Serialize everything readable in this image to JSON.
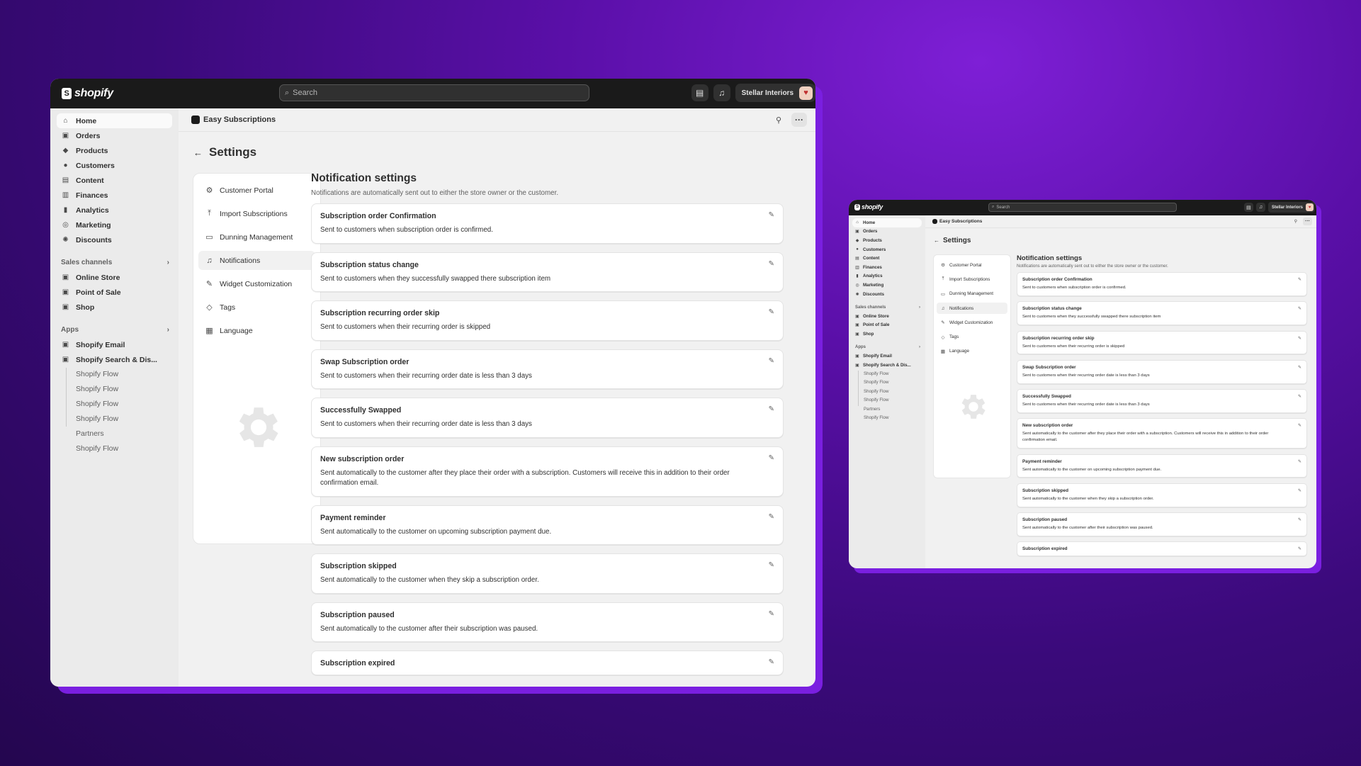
{
  "brand": {
    "logo_text": "shopify"
  },
  "topbar": {
    "search_placeholder": "Search",
    "store_name": "Stellar Interiors"
  },
  "sidebar": {
    "nav": [
      {
        "label": "Home",
        "icon": "home-icon",
        "glyph": "⌂",
        "active": true
      },
      {
        "label": "Orders",
        "icon": "orders-icon",
        "glyph": "▣"
      },
      {
        "label": "Products",
        "icon": "tag-icon",
        "glyph": "◆"
      },
      {
        "label": "Customers",
        "icon": "person-icon",
        "glyph": "●"
      },
      {
        "label": "Content",
        "icon": "content-icon",
        "glyph": "▤"
      },
      {
        "label": "Finances",
        "icon": "bank-icon",
        "glyph": "▥"
      },
      {
        "label": "Analytics",
        "icon": "bar-chart-icon",
        "glyph": "▮"
      },
      {
        "label": "Marketing",
        "icon": "target-icon",
        "glyph": "◎"
      },
      {
        "label": "Discounts",
        "icon": "discount-icon",
        "glyph": "✺"
      }
    ],
    "sales_channels_label": "Sales channels",
    "channels": [
      {
        "label": "Online Store",
        "icon": "store-icon",
        "glyph": "▣"
      },
      {
        "label": "Point of Sale",
        "icon": "pos-icon",
        "glyph": "▣"
      },
      {
        "label": "Shop",
        "icon": "shop-icon",
        "glyph": "▣"
      }
    ],
    "apps_label": "Apps",
    "apps": [
      {
        "label": "Shopify Email",
        "icon": "email-app-icon",
        "glyph": "▣"
      },
      {
        "label": "Shopify Search & Dis...",
        "icon": "search-app-icon",
        "glyph": "▣"
      }
    ],
    "app_sub": [
      "Shopify Flow",
      "Shopify Flow",
      "Shopify Flow",
      "Shopify Flow",
      "Partners",
      "Shopify Flow"
    ]
  },
  "app_header": {
    "title": "Easy Subscriptions"
  },
  "page": {
    "title": "Settings"
  },
  "settings_nav": [
    {
      "label": "Customer Portal",
      "icon": "gear-icon",
      "glyph": "⚙"
    },
    {
      "label": "Import Subscriptions",
      "icon": "upload-icon",
      "glyph": "⤒"
    },
    {
      "label": "Dunning Management",
      "icon": "card-icon",
      "glyph": "▭"
    },
    {
      "label": "Notifications",
      "icon": "bell-icon",
      "glyph": "♫",
      "active": true
    },
    {
      "label": "Widget Customization",
      "icon": "pencil-icon",
      "glyph": "✎"
    },
    {
      "label": "Tags",
      "icon": "tag-icon",
      "glyph": "◇"
    },
    {
      "label": "Language",
      "icon": "language-icon",
      "glyph": "▦"
    }
  ],
  "notifications": {
    "heading": "Notification settings",
    "subheading": "Notifications are automatically sent out to either the store owner or the customer.",
    "cards": [
      {
        "title": "Subscription order Confirmation",
        "desc": "Sent to customers when subscription order is confirmed."
      },
      {
        "title": "Subscription status change",
        "desc": "Sent to customers when they successfully swapped there subscription item"
      },
      {
        "title": "Subscription recurring order skip",
        "desc": "Sent to customers when their recurring order is skipped"
      },
      {
        "title": "Swap Subscription order",
        "desc": "Sent to customers when their recurring order date is less than 3 days"
      },
      {
        "title": "Successfully Swapped",
        "desc": "Sent to customers when their recurring order date is less than 3 days"
      },
      {
        "title": "New subscription order",
        "desc": "Sent automatically to the customer after they place their order with a subscription. Customers will receive this in addition to their order confirmation email."
      },
      {
        "title": "Payment reminder",
        "desc": "Sent automatically to the customer on upcoming subscription payment due."
      },
      {
        "title": "Subscription skipped",
        "desc": "Sent automatically to the customer when they skip a subscription order."
      },
      {
        "title": "Subscription paused",
        "desc": "Sent automatically to the customer after their subscription was paused."
      },
      {
        "title": "Subscription expired",
        "desc": ""
      }
    ]
  },
  "colors": {
    "accent_purple": "#7a1fe0",
    "topbar_dark": "#1a1a1a",
    "surface": "#f1f1f1"
  }
}
